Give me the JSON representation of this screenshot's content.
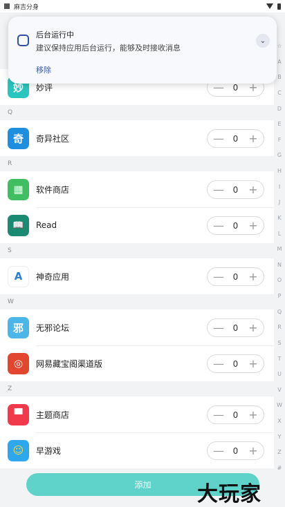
{
  "status_bar": {
    "app_label": "麻吉分身"
  },
  "notification": {
    "title": "后台运行中",
    "body": "建议保持应用后台运行，能够及时接收消息",
    "action": "移除",
    "expand_glyph": "⌄"
  },
  "stepper": {
    "minus": "—",
    "plus": "+"
  },
  "sections": {
    "q": "Q",
    "r": "R",
    "s": "S",
    "w": "W",
    "z": "Z"
  },
  "apps": [
    {
      "name": "妙评",
      "count": "0",
      "icon_glyph": "妙",
      "icon_color": "#29c6c0"
    },
    {
      "name": "奇异社区",
      "count": "0",
      "icon_glyph": "奇",
      "icon_color": "#1e8fe0"
    },
    {
      "name": "软件商店",
      "count": "0",
      "icon_glyph": "▦",
      "icon_color": "#3fbf62"
    },
    {
      "name": "Read",
      "count": "0",
      "icon_glyph": "📖",
      "icon_color": "#1a8a72"
    },
    {
      "name": "神奇应用",
      "count": "0",
      "icon_glyph": "A",
      "icon_color": "#2a7fd6"
    },
    {
      "name": "无邪论坛",
      "count": "0",
      "icon_glyph": "邪",
      "icon_color": "#4cb6e8"
    },
    {
      "name": "网易藏宝阁渠道版",
      "count": "0",
      "icon_glyph": "◎",
      "icon_color": "#e3462f"
    },
    {
      "name": "主题商店",
      "count": "0",
      "icon_glyph": "▀",
      "icon_color": "#f2384b"
    },
    {
      "name": "早游戏",
      "count": "0",
      "icon_glyph": "☺",
      "icon_color": "#2da8ef"
    }
  ],
  "alphabet": [
    "☆",
    "A",
    "B",
    "C",
    "D",
    "E",
    "F",
    "G",
    "H",
    "I",
    "J",
    "K",
    "L",
    "M",
    "N",
    "O",
    "P",
    "Q",
    "R",
    "S",
    "T",
    "U",
    "V",
    "W",
    "X",
    "Y",
    "Z",
    "#"
  ],
  "add_button": "添加",
  "watermark": "大玩家"
}
